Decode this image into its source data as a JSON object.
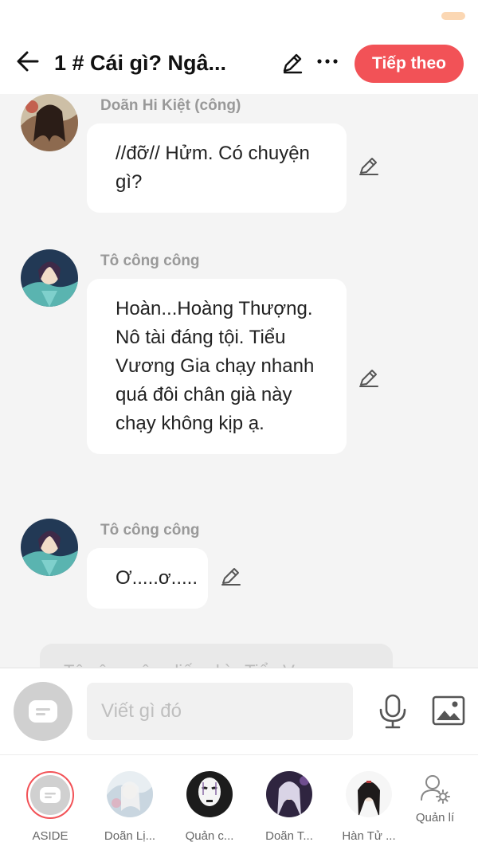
{
  "header": {
    "title": "1 # Cái gì? Ngâ...",
    "next_label": "Tiếp theo"
  },
  "messages": [
    {
      "sender": "Doãn Hi Kiệt (công)",
      "text": "//đỡ// Hửm. Có chuyện gì?"
    },
    {
      "sender": "Tô công công",
      "text": "Hoàn...Hoàng Thượng. Nô tài đáng tội. Tiểu Vương Gia chạy nhanh quá đôi chân già này chạy không kịp ạ."
    },
    {
      "sender": "Tô công công",
      "text": "Ơ.....ơ....."
    }
  ],
  "aside_peek_text": "Tô công công liếc nhìn Tiểu V...",
  "composer": {
    "placeholder": "Viết gì đó",
    "mic_icon": "microphone-icon",
    "image_icon": "image-icon"
  },
  "tabs": [
    {
      "label": "ASIDE"
    },
    {
      "label": "Doãn Lị..."
    },
    {
      "label": "Quản c..."
    },
    {
      "label": "Doãn T..."
    },
    {
      "label": "Hàn Tử ..."
    },
    {
      "label": "Quản lí"
    }
  ],
  "colors": {
    "accent": "#f25257",
    "sender_gray": "#999999",
    "background": "#f4f4f4"
  }
}
